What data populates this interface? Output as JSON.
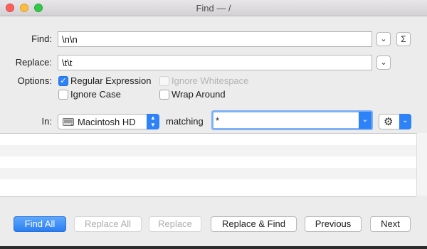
{
  "window": {
    "title": "Find — /"
  },
  "find": {
    "label": "Find:",
    "value": "\\n\\n",
    "menu_glyph": "⌄",
    "sigma_glyph": "Σ"
  },
  "replace": {
    "label": "Replace:",
    "value": "\\t\\t",
    "menu_glyph": "⌄"
  },
  "options": {
    "label": "Options:",
    "regular_expression": {
      "label": "Regular Expression",
      "checked": true
    },
    "ignore_whitespace": {
      "label": "Ignore Whitespace",
      "checked": false,
      "enabled": false
    },
    "ignore_case": {
      "label": "Ignore Case",
      "checked": false
    },
    "wrap_around": {
      "label": "Wrap Around",
      "checked": false
    }
  },
  "scope": {
    "in_label": "In:",
    "location_value": "Macintosh HD",
    "matching_label": "matching",
    "matching_value": "*",
    "gear_glyph": "⚙"
  },
  "buttons": {
    "find_all": "Find All",
    "replace_all": "Replace All",
    "replace": "Replace",
    "replace_and_find": "Replace & Find",
    "previous": "Previous",
    "next": "Next"
  },
  "colors": {
    "accent": "#2e82f7"
  }
}
